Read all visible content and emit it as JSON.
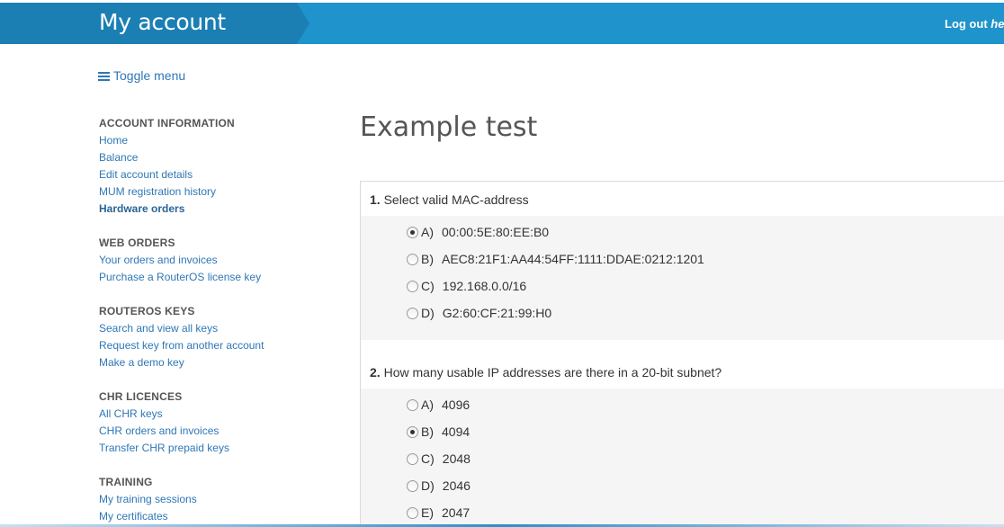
{
  "header": {
    "title": "My account",
    "logout_prefix": "Log out ",
    "logout_link": "here"
  },
  "toggle_menu": {
    "label": "Toggle menu"
  },
  "sidebar": {
    "sections": [
      {
        "heading": "ACCOUNT INFORMATION",
        "items": [
          "Home",
          "Balance",
          "Edit account details",
          "MUM registration history",
          "Hardware orders"
        ]
      },
      {
        "heading": "WEB ORDERS",
        "items": [
          "Your orders and invoices",
          "Purchase a RouterOS license key"
        ]
      },
      {
        "heading": "ROUTEROS KEYS",
        "items": [
          "Search and view all keys",
          "Request key from another account",
          "Make a demo key"
        ]
      },
      {
        "heading": "CHR LICENCES",
        "items": [
          "All CHR keys",
          "CHR orders and invoices",
          "Transfer CHR prepaid keys"
        ]
      },
      {
        "heading": "TRAINING",
        "items": [
          "My training sessions",
          "My certificates"
        ]
      }
    ],
    "active_item": "Hardware orders"
  },
  "main": {
    "title": "Example test",
    "questions": [
      {
        "number": "1.",
        "text": "Select valid MAC-address",
        "options": [
          {
            "letter": "A)",
            "text": "00:00:5E:80:EE:B0",
            "checked": true
          },
          {
            "letter": "B)",
            "text": "AEC8:21F1:AA44:54FF:1111:DDAE:0212:1201",
            "checked": false
          },
          {
            "letter": "C)",
            "text": "192.168.0.0/16",
            "checked": false
          },
          {
            "letter": "D)",
            "text": "G2:60:CF:21:99:H0",
            "checked": false
          }
        ]
      },
      {
        "number": "2.",
        "text": "How many usable IP addresses are there in a 20-bit subnet?",
        "options": [
          {
            "letter": "A)",
            "text": "4096",
            "checked": false
          },
          {
            "letter": "B)",
            "text": "4094",
            "checked": true
          },
          {
            "letter": "C)",
            "text": "2048",
            "checked": false
          },
          {
            "letter": "D)",
            "text": "2046",
            "checked": false
          },
          {
            "letter": "E)",
            "text": "2047",
            "checked": false
          }
        ]
      }
    ]
  },
  "colors": {
    "header": "#1f93cc",
    "header_band": "#1b7fb4",
    "link": "#2e77b6",
    "options_background": "#f5f5f5"
  }
}
